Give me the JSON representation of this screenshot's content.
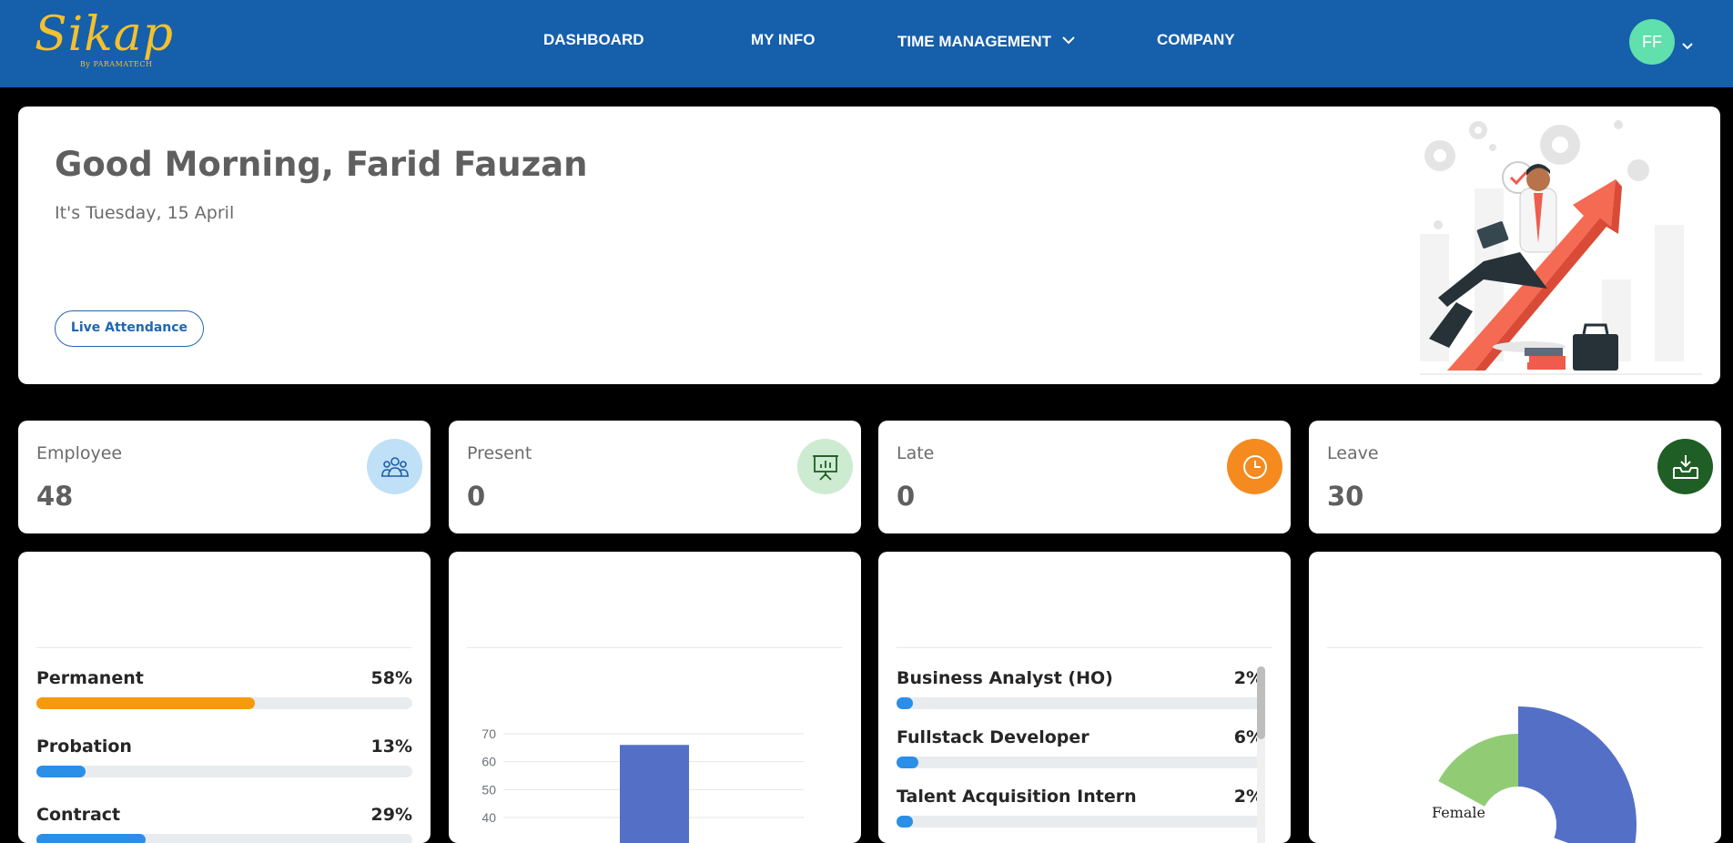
{
  "brand": {
    "name": "Sikap",
    "sub": "By PARAMATECH",
    "color": "#f2c12e"
  },
  "nav": {
    "dashboard": "DASHBOARD",
    "my_info": "MY INFO",
    "time_management": "TIME MANAGEMENT",
    "company": "COMPANY"
  },
  "user": {
    "initials": "FF"
  },
  "hero": {
    "greeting": "Good Morning, Farid Fauzan",
    "date": "It's Tuesday, 15 April",
    "button": "Live Attendance"
  },
  "stats": [
    {
      "label": "Employee",
      "value": "48",
      "icon": "users-icon",
      "color": "#bfe0f7"
    },
    {
      "label": "Present",
      "value": "0",
      "icon": "presentation-chart-icon",
      "color": "#cdebd1"
    },
    {
      "label": "Late",
      "value": "0",
      "icon": "clock-icon",
      "color": "#f58a1f"
    },
    {
      "label": "Leave",
      "value": "30",
      "icon": "inbox-download-icon",
      "color": "#1f5e24"
    }
  ],
  "employment_status": [
    {
      "label": "Permanent",
      "pct": "58%",
      "value": 58,
      "color": "#f59a0c"
    },
    {
      "label": "Probation",
      "pct": "13%",
      "value": 13,
      "color": "#2b8fe8"
    },
    {
      "label": "Contract",
      "pct": "29%",
      "value": 29,
      "color": "#2b8fe8"
    }
  ],
  "positions": [
    {
      "label": "Business Analyst (HO)",
      "pct": "2%",
      "value": 2,
      "color": "#2b8fe8"
    },
    {
      "label": "Fullstack Developer",
      "pct": "6%",
      "value": 6,
      "color": "#2b8fe8"
    },
    {
      "label": "Talent Acquisition Intern",
      "pct": "2%",
      "value": 2,
      "color": "#2b8fe8"
    }
  ],
  "chart_data": [
    {
      "type": "bar",
      "y_ticks": [
        "70",
        "60",
        "50",
        "40"
      ],
      "ylim": [
        40,
        70
      ],
      "values": [
        66
      ],
      "color": "#5470c6",
      "grid": true
    },
    {
      "type": "pie",
      "labels": [
        "Female"
      ],
      "colors": [
        "#5470c6",
        "#91cc75"
      ],
      "donut": true
    }
  ]
}
